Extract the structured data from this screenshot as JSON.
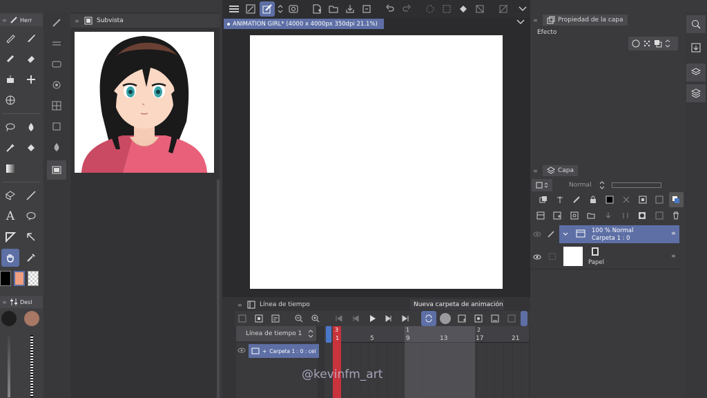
{
  "tools_panel": {
    "title": "Herr"
  },
  "color_panel": {
    "title": "Desl"
  },
  "subview": {
    "title": "Subvista"
  },
  "document_tab": {
    "label": "ANIMATION GIRL* (4000 x 4000px 350dpi 21.1%)"
  },
  "layer_property": {
    "title": "Propiedad de la capa",
    "effect_label": "Efecto"
  },
  "layer_panel": {
    "title": "Capa",
    "blend_mode": "Normal",
    "layers": [
      {
        "opacity_mode": "100 %  Normal",
        "name": "Carpeta 1 : 0"
      },
      {
        "name": "Papel"
      }
    ]
  },
  "timeline": {
    "title": "Línea de tiempo",
    "new_folder_label": "Nueva carpeta de animación",
    "select_label": "Línea de tiempo 1",
    "track_label": "Carpeta 1 : 0 : cel",
    "ruler_numbers": [
      "3",
      "1",
      "5",
      "1",
      "9",
      "13",
      "2",
      "17",
      "21"
    ]
  },
  "watermark": "@kevinfm_art",
  "colors": {
    "main": "#000000",
    "sub": "#f0a080",
    "selection": "#5d6fa5",
    "playhead": "#c8333c"
  }
}
